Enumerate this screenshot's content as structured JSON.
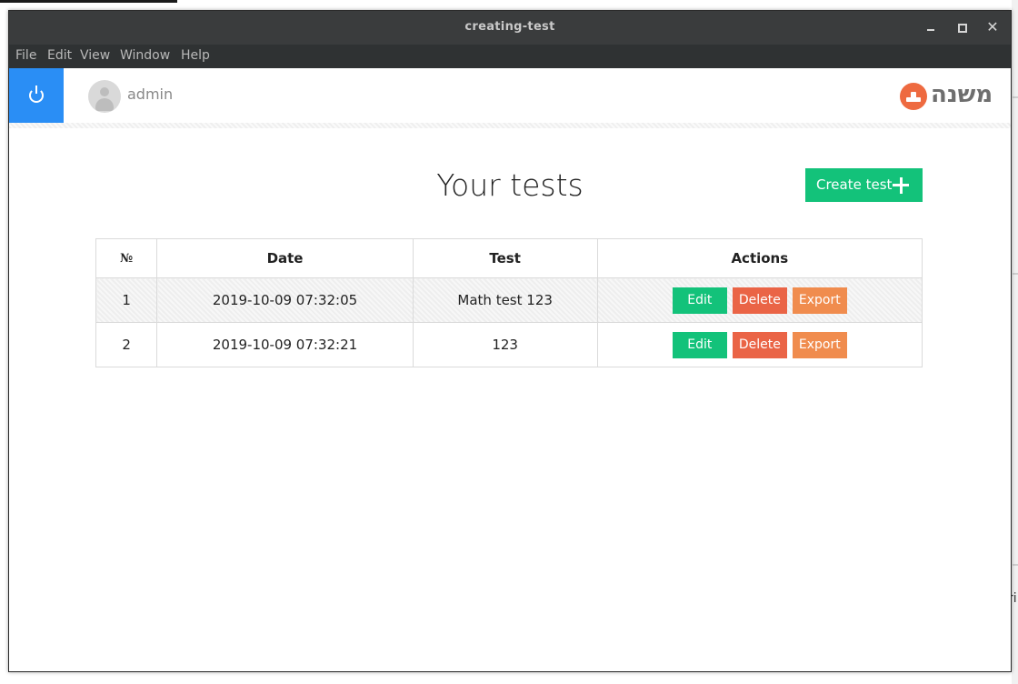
{
  "window": {
    "title": "creating-test"
  },
  "menu": [
    "File",
    "Edit",
    "View",
    "Window",
    "Help"
  ],
  "header": {
    "username": "admin",
    "logo_text": "משנה"
  },
  "page": {
    "title": "Your tests",
    "create_label": "Create test"
  },
  "table": {
    "columns": [
      "№",
      "Date",
      "Test",
      "Actions"
    ],
    "rows": [
      {
        "num": "1",
        "date": "2019-10-09 07:32:05",
        "test": "Math test 123"
      },
      {
        "num": "2",
        "date": "2019-10-09 07:32:21",
        "test": "123"
      }
    ],
    "actions": {
      "edit": "Edit",
      "delete": "Delete",
      "export": "Export"
    }
  },
  "desktop": {
    "fragment": "ri"
  },
  "colors": {
    "accent_blue": "#2a8ef5",
    "green": "#13c27a",
    "red": "#ea6446",
    "orange": "#f08c4e",
    "logo_orange": "#ee6a40"
  },
  "icons": {
    "power": "power-icon",
    "avatar": "user-avatar-icon",
    "plus": "plus-icon"
  }
}
